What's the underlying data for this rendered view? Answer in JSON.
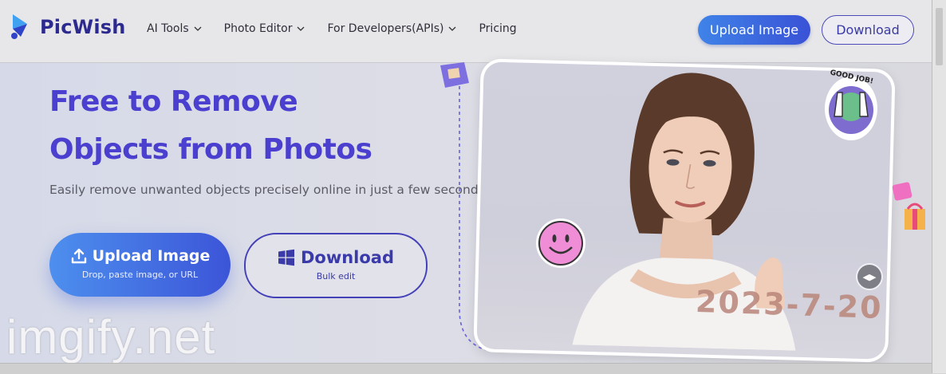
{
  "brand": {
    "name": "PicWish",
    "accent": "#4a3fcf",
    "button_blue": "#3f6ee0"
  },
  "nav": {
    "items": [
      {
        "label": "AI Tools",
        "has_dropdown": true
      },
      {
        "label": "Photo Editor",
        "has_dropdown": true
      },
      {
        "label": "For Developers(APIs)",
        "has_dropdown": true
      },
      {
        "label": "Pricing",
        "has_dropdown": false
      }
    ],
    "upload_label": "Upload Image",
    "download_label": "Download"
  },
  "hero": {
    "title_line1": "Free to Remove",
    "title_line2": "Objects from Photos",
    "subtitle": "Easily remove unwanted objects precisely online in just a few seconds",
    "upload_button": {
      "label": "Upload Image",
      "sub": "Drop, paste image, or URL"
    },
    "download_button": {
      "label": "Download",
      "sub": "Bulk edit"
    }
  },
  "preview": {
    "date_stamp": "2023-7-20",
    "sticker_text": "GOOD JOB!"
  },
  "watermark": "imgify.net"
}
